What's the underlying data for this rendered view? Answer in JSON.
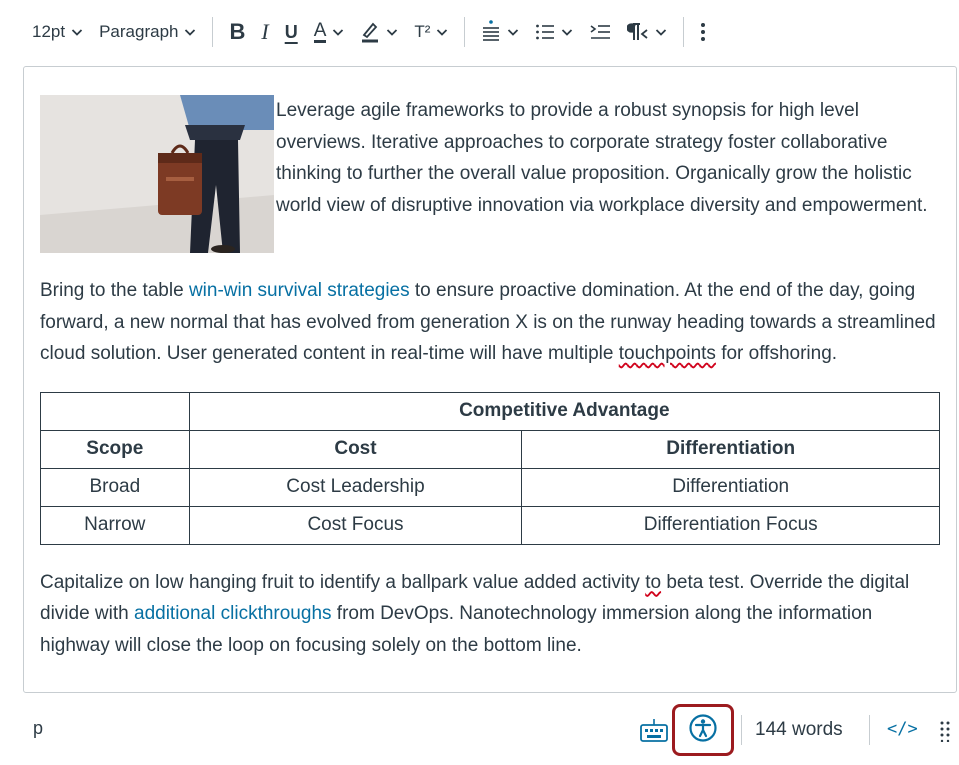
{
  "toolbar": {
    "font_size": "12pt",
    "block_format": "Paragraph",
    "bold": "B",
    "italic": "I",
    "underline": "U",
    "text_color": "A",
    "superscript": "T²",
    "icons": [
      "chevron-down-icon",
      "bold-icon",
      "italic-icon",
      "underline-icon",
      "text-color-icon",
      "highlight-icon",
      "superscript-icon",
      "align-icon",
      "list-icon",
      "indent-icon",
      "paragraph-direction-icon",
      "more-icon"
    ]
  },
  "content": {
    "p1": "Leverage agile frameworks to provide a robust synopsis for high level overviews. Iterative approaches to corporate strategy foster collaborative thinking to further the overall value proposition. Organically grow the holistic world view of disruptive innovation via workplace diversity and empowerment.",
    "p2_before": "Bring to the table ",
    "p2_link": "win-win survival strategies",
    "p2_mid": " to ensure proactive domination. At the end of the day, going forward, a new normal that has evolved from generation X is on the runway heading towards a streamlined cloud solution. User generated content in real-time will have multiple ",
    "p2_spell": "touchpoints",
    "p2_after": " for offshoring.",
    "table": {
      "group_header": "Competitive Advantage",
      "headers": [
        "Scope",
        "Cost",
        "Differentiation"
      ],
      "rows": [
        [
          "Broad",
          "Cost Leadership",
          "Differentiation"
        ],
        [
          "Narrow",
          "Cost Focus",
          "Differentiation Focus"
        ]
      ]
    },
    "p3_before": "Capitalize on low hanging fruit to identify a ballpark value added activity ",
    "p3_spell": "to",
    "p3_mid": " beta test. Override the digital divide with ",
    "p3_link": "additional clickthroughs",
    "p3_after": " from DevOps. Nanotechnology immersion along the information highway will close the loop on focusing solely on the bottom line."
  },
  "statusbar": {
    "path": "p",
    "word_count": "144 words",
    "html_toggle": "</>"
  },
  "colors": {
    "text": "#2d3b45",
    "link": "#0770a3",
    "border": "#c7cdd1",
    "highlight_box": "#9c1b1f",
    "accent_icon": "#0770a3"
  }
}
